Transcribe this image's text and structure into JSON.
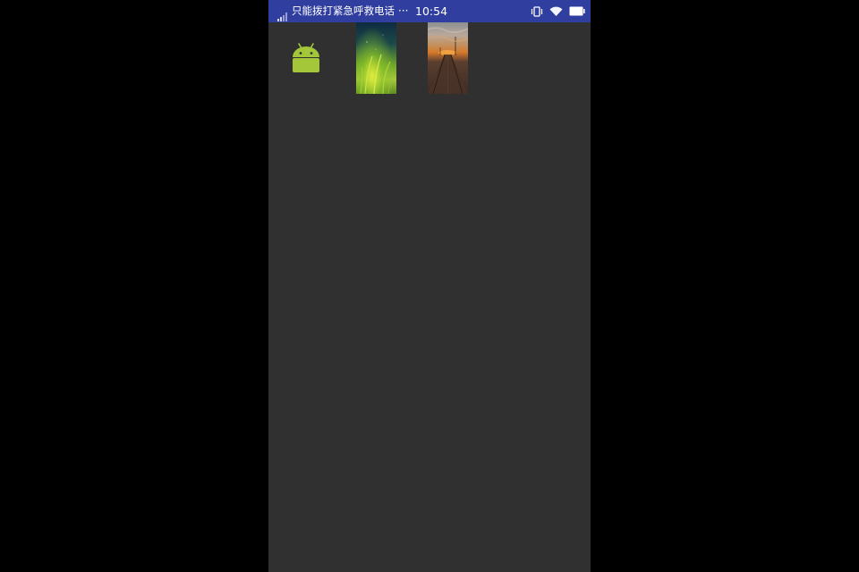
{
  "status_bar": {
    "carrier_text": "只能拨打紧急呼救电话",
    "more_indicator": "···",
    "time": "10:54",
    "background_color": "#303f9f",
    "icons": [
      "signal-icon",
      "vibrate-icon",
      "wifi-icon",
      "battery-icon"
    ]
  },
  "screen": {
    "background_color": "#303030",
    "items": [
      {
        "name": "android-logo",
        "icon": "android-icon",
        "color": "#a4c639"
      },
      {
        "name": "grass-wallpaper-image",
        "icon": "image"
      },
      {
        "name": "pier-sunset-image",
        "icon": "image"
      }
    ]
  }
}
